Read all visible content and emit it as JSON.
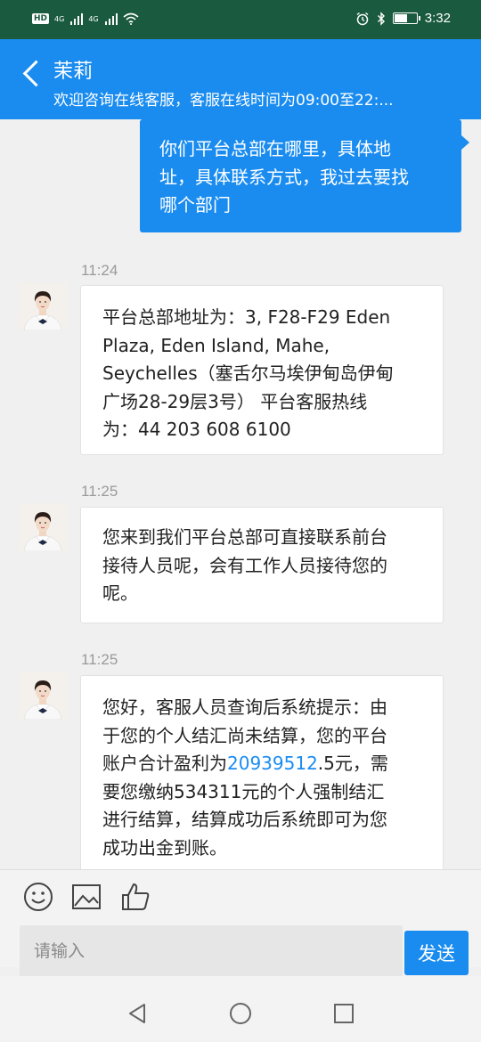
{
  "status_bar": {
    "left_chip": "HD",
    "network_1": "4G",
    "network_2": "4G",
    "time": "3:32",
    "battery_level": 0.55,
    "icons": [
      "alarm-icon",
      "bluetooth-icon",
      "wifi-icon",
      "battery-icon"
    ]
  },
  "header": {
    "contact_name": "茉莉",
    "subtitle": "欢迎咨询在线客服，客服在线时间为09:00至22:..."
  },
  "messages": [
    {
      "from": "me",
      "lines": [
        "你们平台总部在哪里，具体地",
        "址，具体联系方式，我过去要找",
        "哪个部门"
      ]
    },
    {
      "from": "agent",
      "time": "11:24",
      "lines": [
        "平台总部地址为：3, F28-F29 Eden",
        "Plaza, Eden Island, Mahe,",
        "Seychelles（塞舌尔马埃伊甸岛伊甸",
        "广场28-29层3号） 平台客服热线",
        "为：44 203 608 6100"
      ]
    },
    {
      "from": "agent",
      "time": "11:25",
      "lines": [
        "您来到我们平台总部可直接联系前台",
        "接待人员呢，会有工作人员接待您的",
        "呢。"
      ]
    },
    {
      "from": "agent",
      "time": "11:25",
      "lines_before": [
        "您好，客服人员查询后系统提示：由",
        "于您的个人结汇尚未结算，您的平台"
      ],
      "line_linked": {
        "prefix": "账户合计盈利为",
        "link": "20939512",
        "suffix": ".5元，需"
      },
      "lines_after": [
        "要您缴纳534311元的个人强制结汇",
        "进行结算，结算成功后系统即可为您",
        "成功出金到账。"
      ]
    }
  ],
  "input": {
    "placeholder": "请输入",
    "send_label": "发送",
    "tools": [
      "emoji-icon",
      "image-icon",
      "thumbs-up-icon"
    ]
  },
  "colors": {
    "accent": "#1a8cf0",
    "status_bar": "#1a5a3f"
  }
}
